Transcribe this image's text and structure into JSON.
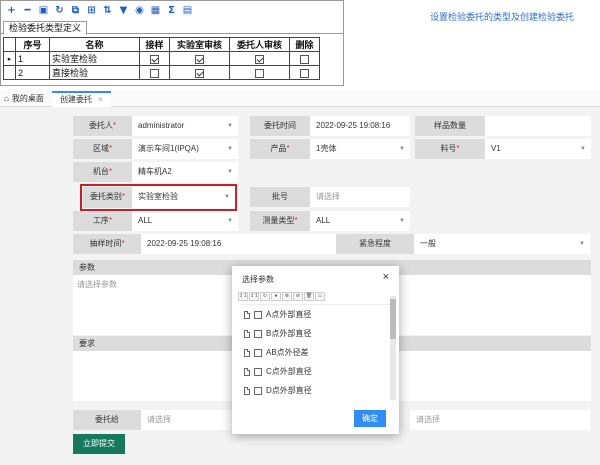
{
  "toolbar": {
    "icons": [
      "plus-icon",
      "minus-icon",
      "save-icon",
      "refresh-icon",
      "copy-icon",
      "import-icon",
      "sort-icon",
      "filter-icon",
      "binoculars-icon",
      "calculator-icon",
      "sigma-icon",
      "excel-icon"
    ],
    "glyphs": [
      "+",
      "━",
      "▣",
      "↻",
      "⧉",
      "⊞",
      "⇅",
      "▼",
      "◉",
      "▦",
      "Σ",
      "▤"
    ]
  },
  "type_window": {
    "tab_label": "检验委托类型定义",
    "columns": [
      "序号",
      "名称",
      "接样",
      "实验室审核",
      "委托人审核",
      "删除"
    ],
    "rows": [
      {
        "no": "1",
        "name": "实验室检验",
        "sample": true,
        "lab_review": true,
        "client_review": true,
        "delete": false
      },
      {
        "no": "2",
        "name": "直接检验",
        "sample": false,
        "lab_review": true,
        "client_review": false,
        "delete": false
      }
    ]
  },
  "hint_text": "设置检验委托的类型及创建检验委托",
  "tabs": {
    "home": "我的桌面",
    "create": "创建委托",
    "close": "×"
  },
  "form": {
    "client": {
      "label": "委托人",
      "value": "administrator"
    },
    "entrust_time": {
      "label": "委托时间",
      "value": "2022-09-25 19:08:16"
    },
    "sample_qty": {
      "label": "样品数量"
    },
    "area": {
      "label": "区域",
      "value": "演示车间1(IPQA)"
    },
    "product": {
      "label": "产品",
      "value": "1壳体"
    },
    "material_no": {
      "label": "料号",
      "value": "V1"
    },
    "machine": {
      "label": "机台",
      "value": "精车机A2"
    },
    "entrust_type": {
      "label": "委托类别",
      "value": "实验室检验"
    },
    "batch": {
      "label": "批号",
      "placeholder": "请选择"
    },
    "process": {
      "label": "工序",
      "value": "ALL"
    },
    "measure_type": {
      "label": "测量类型",
      "value": "ALL"
    },
    "sampling_time": {
      "label": "抽样时间",
      "value": "2022-09-25 19:08:16"
    },
    "urgency": {
      "label": "紧急程度",
      "value": "一般"
    },
    "params": {
      "label": "参数",
      "placeholder": "请选择参数"
    },
    "requirement": {
      "label": "要求"
    },
    "entrust_to": {
      "label": "委托给",
      "placeholder": "请选择",
      "placeholder2": "请选择"
    },
    "submit": "立即提交",
    "req_mark": "*"
  },
  "modal": {
    "title": "选择参数",
    "close": "×",
    "tools": [
      "↥↧",
      "↥↧",
      "↻",
      "●",
      "⊗",
      "⊘",
      "🗑",
      "▭"
    ],
    "items": [
      "A点外部直径",
      "B点外部直径",
      "AB点外径差",
      "C点外部直径",
      "D点外部直径"
    ],
    "ok": "确定"
  }
}
